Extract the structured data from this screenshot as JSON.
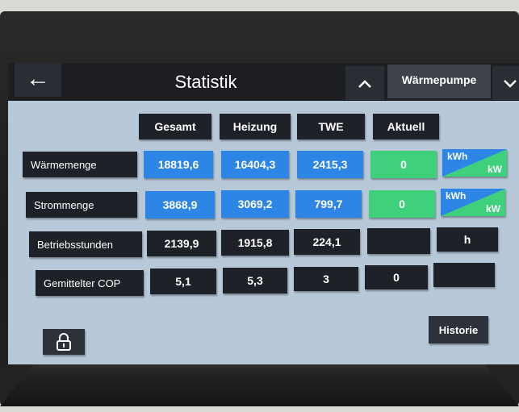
{
  "header": {
    "back_icon": "arrow-left-icon",
    "title": "Statistik",
    "up_icon": "chevron-up-icon",
    "mode_tab": "Wärmepumpe",
    "down_icon": "chevron-down-icon"
  },
  "table": {
    "columns": [
      "Gesamt",
      "Heizung",
      "TWE",
      "Aktuell"
    ],
    "rows": [
      {
        "label": "Wärmemenge",
        "values": [
          "18819,6",
          "16404,3",
          "2415,3"
        ],
        "current": "0",
        "unit_top": "kWh",
        "unit_bottom": "kW"
      },
      {
        "label": "Strommenge",
        "values": [
          "3868,9",
          "3069,2",
          "799,7"
        ],
        "current": "0",
        "unit_top": "kWh",
        "unit_bottom": "kW"
      },
      {
        "label": "Betriebsstunden",
        "values": [
          "2139,9",
          "1915,8",
          "224,1"
        ],
        "current": "",
        "unit": "h"
      },
      {
        "label": "Gemittelter COP",
        "values": [
          "5,1",
          "5,3",
          "3"
        ],
        "current": "0",
        "unit": ""
      }
    ]
  },
  "footer": {
    "lock_icon": "lock-icon",
    "historie_label": "Historie"
  },
  "colors": {
    "accent": "#38b9d9",
    "blue_cell": "#2d86e6",
    "green_cell": "#3ed07a",
    "dark_cell": "#1e2127",
    "panel": "#b7c9d9"
  }
}
